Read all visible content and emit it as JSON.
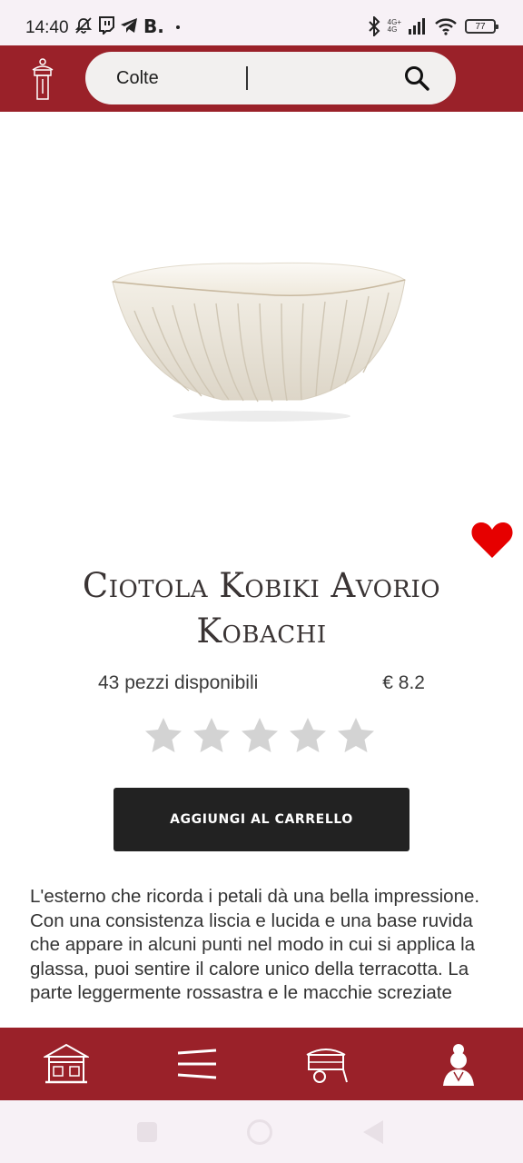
{
  "status_bar": {
    "time": "14:40",
    "network_label_top": "4G+",
    "network_label_bottom": "4G",
    "battery": "77",
    "icons": [
      "notification-off-icon",
      "twitch-icon",
      "telegram-icon",
      "b-app-icon",
      "dot-icon",
      "bluetooth-icon",
      "signal-icon",
      "wifi-icon",
      "battery-icon"
    ]
  },
  "header": {
    "search_value": "Colte",
    "icons": [
      "lantern-logo-icon",
      "search-icon"
    ],
    "colors": {
      "brand": "#9a2129",
      "search_bg": "#f2f0ef"
    }
  },
  "product": {
    "title_line1": "Ciotola Kobiki Avorio",
    "title_line2": "Kobachi",
    "stock": "43 pezzi disponibili",
    "price": "€ 8.2",
    "rating": 0,
    "max_rating": 5,
    "favorite": true,
    "add_to_cart_label": "Aggiungi al carrello",
    "description": "L'esterno che ricorda i petali dà una bella impressione. Con una consistenza liscia e lucida e una base ruvida che appare in alcuni punti nel modo in cui si applica la glassa, puoi sentire il calore unico della terracotta. La parte leggermente rossastra e le macchie screziate",
    "colors": {
      "favorite": "#e60000",
      "star_empty": "#d3d3d3",
      "button": "#222222"
    }
  },
  "bottom_nav": {
    "icons": [
      "house-icon",
      "chopsticks-icon",
      "food-cart-icon",
      "geisha-icon"
    ]
  }
}
